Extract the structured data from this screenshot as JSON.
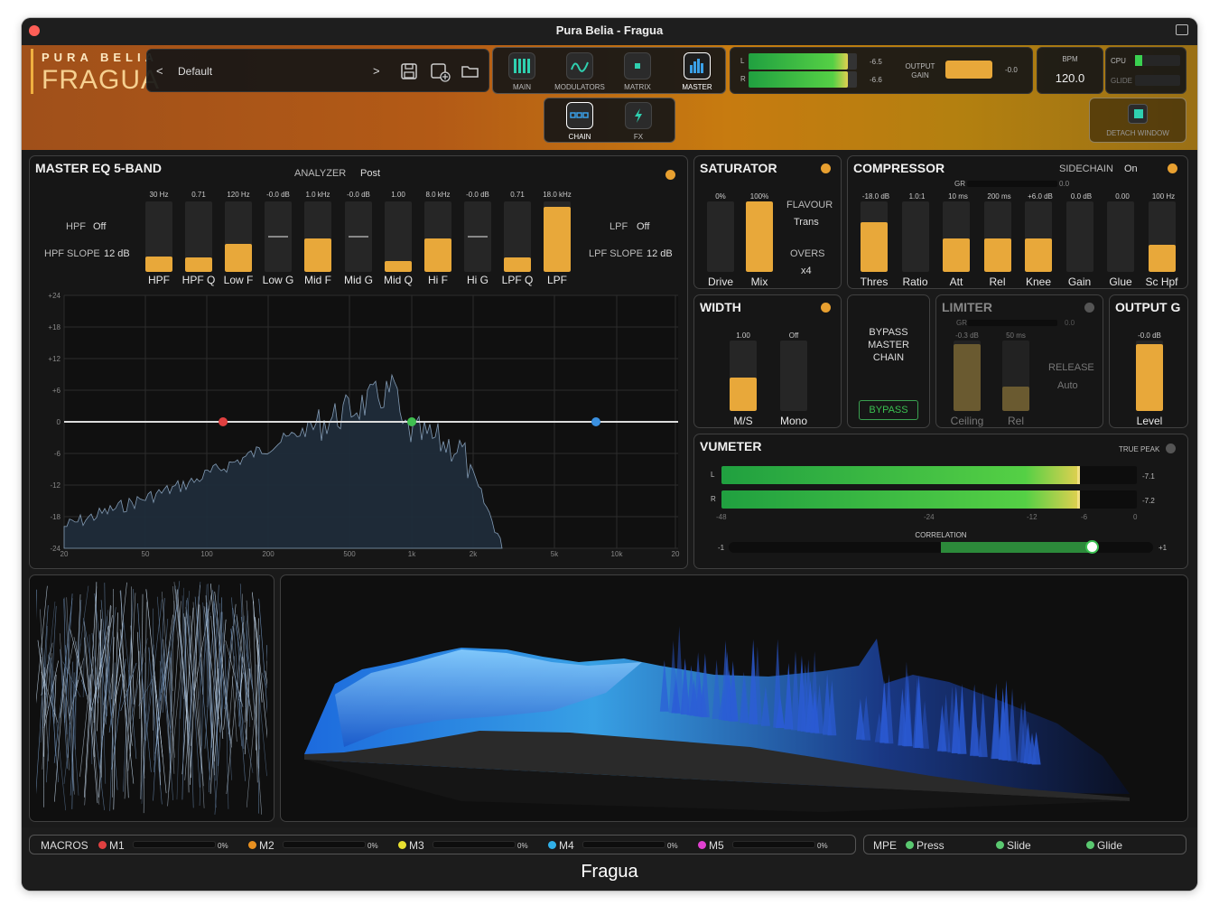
{
  "window_title": "Pura Belia - Fragua",
  "logo": {
    "top": "PURA BELIA",
    "main": "FRAGUA"
  },
  "preset": {
    "prev": "<",
    "name": "Default",
    "next": ">"
  },
  "nav": [
    {
      "label": "MAIN",
      "icon": "bars-icon"
    },
    {
      "label": "MODULATORS",
      "icon": "wave-icon"
    },
    {
      "label": "MATRIX",
      "icon": "matrix-icon"
    },
    {
      "label": "MASTER",
      "icon": "master-icon"
    }
  ],
  "subnav": [
    {
      "label": "CHAIN",
      "icon": "chain-icon"
    },
    {
      "label": "FX",
      "icon": "lightning-icon"
    }
  ],
  "output_meter": {
    "l_label": "L",
    "r_label": "R",
    "l_value": "-6.5",
    "r_value": "-6.6",
    "l_level": 0.92,
    "r_level": 0.92,
    "gain_label": "OUTPUT GAIN",
    "gain_value": "-0.0"
  },
  "bpm": {
    "label": "BPM",
    "value": "120.0"
  },
  "cpu": {
    "label": "CPU",
    "glide_label": "GLIDE"
  },
  "detach": {
    "label": "DETACH WINDOW"
  },
  "eq": {
    "title": "MASTER EQ 5-BAND",
    "analyzer_label": "ANALYZER",
    "analyzer_value": "Post",
    "hpf_label": "HPF",
    "hpf_value": "Off",
    "hpf_slope_label": "HPF SLOPE",
    "hpf_slope_value": "12 dB",
    "lpf_label": "LPF",
    "lpf_value": "Off",
    "lpf_slope_label": "LPF SLOPE",
    "lpf_slope_value": "12 dB",
    "bands": [
      {
        "name": "HPF",
        "value": "30 Hz",
        "level": 0.22
      },
      {
        "name": "HPF Q",
        "value": "0.71",
        "level": 0.2
      },
      {
        "name": "Low F",
        "value": "120 Hz",
        "level": 0.4
      },
      {
        "name": "Low G",
        "value": "-0.0 dB",
        "level": null
      },
      {
        "name": "Mid F",
        "value": "1.0 kHz",
        "level": 0.48
      },
      {
        "name": "Mid G",
        "value": "-0.0 dB",
        "level": null
      },
      {
        "name": "Mid Q",
        "value": "1.00",
        "level": 0.16
      },
      {
        "name": "Hi F",
        "value": "8.0 kHz",
        "level": 0.48
      },
      {
        "name": "Hi G",
        "value": "-0.0 dB",
        "level": null
      },
      {
        "name": "LPF Q",
        "value": "0.71",
        "level": 0.2
      },
      {
        "name": "LPF",
        "value": "18.0 kHz",
        "level": 0.92
      }
    ],
    "y_ticks": [
      "+24",
      "+18",
      "+12",
      "+6",
      "0",
      "-6",
      "-12",
      "-18",
      "-24"
    ],
    "x_ticks": [
      "20",
      "50",
      "100",
      "200",
      "500",
      "1k",
      "2k",
      "5k",
      "10k",
      "20"
    ]
  },
  "saturator": {
    "title": "SATURATOR",
    "drive_label": "Drive",
    "drive_value": "0%",
    "drive_level": 0,
    "mix_label": "Mix",
    "mix_value": "100%",
    "mix_level": 1,
    "flavour_label": "FLAVOUR",
    "flavour_value": "Trans",
    "overs_label": "OVERS",
    "overs_value": "x4"
  },
  "compressor": {
    "title": "COMPRESSOR",
    "sidechain_label": "SIDECHAIN",
    "sidechain_value": "On",
    "gr_label": "GR",
    "gr_value": "0.0",
    "params": [
      {
        "name": "Thres",
        "value": "-18.0 dB",
        "level": 0.7
      },
      {
        "name": "Ratio",
        "value": "1.0:1",
        "level": 0
      },
      {
        "name": "Att",
        "value": "10 ms",
        "level": 0.48
      },
      {
        "name": "Rel",
        "value": "200 ms",
        "level": 0.48
      },
      {
        "name": "Knee",
        "value": "+6.0 dB",
        "level": 0.48
      },
      {
        "name": "Gain",
        "value": "0.0 dB",
        "level": 0
      },
      {
        "name": "Glue",
        "value": "0.00",
        "level": 0
      },
      {
        "name": "Sc Hpf",
        "value": "100 Hz",
        "level": 0.38
      }
    ]
  },
  "width": {
    "title": "WIDTH",
    "ms_label": "M/S",
    "ms_value": "1.00",
    "ms_level": 0.48,
    "mono_label": "Mono",
    "mono_value": "Off"
  },
  "bypass": {
    "text": "BYPASS MASTER CHAIN",
    "button": "BYPASS"
  },
  "limiter": {
    "title": "LIMITER",
    "gr_label": "GR",
    "gr_value": "0.0",
    "ceiling_label": "Ceiling",
    "ceiling_value": "-0.3 dB",
    "ceiling_level": 0.95,
    "rel_label": "Rel",
    "rel_value": "50 ms",
    "rel_level": 0.35,
    "release_label": "RELEASE",
    "release_value": "Auto"
  },
  "output_g": {
    "title": "OUTPUT G",
    "level_label": "Level",
    "level_value": "-0.0 dB",
    "level": 0.95
  },
  "vumeter": {
    "title": "VUMETER",
    "truepeak_label": "TRUE PEAK",
    "l_label": "L",
    "r_label": "R",
    "l_value": "-7.1",
    "r_value": "-7.2",
    "l_level": 0.98,
    "r_level": 0.98,
    "scale": [
      "-48",
      "-24",
      "-12",
      "-6",
      "0"
    ],
    "correlation_label": "CORRELATION",
    "corr_min": "-1",
    "corr_max": "+1",
    "correlation": 0.75
  },
  "macros": {
    "label": "MACROS",
    "items": [
      {
        "name": "M1",
        "value": "0%",
        "color": "#e04040"
      },
      {
        "name": "M2",
        "value": "0%",
        "color": "#e89020"
      },
      {
        "name": "M3",
        "value": "0%",
        "color": "#e8e030"
      },
      {
        "name": "M4",
        "value": "0%",
        "color": "#30b0e8"
      },
      {
        "name": "M5",
        "value": "0%",
        "color": "#e040d0"
      }
    ]
  },
  "mpe": {
    "label": "MPE",
    "items": [
      "Press",
      "Slide",
      "Glide"
    ]
  },
  "footer": "Fragua"
}
